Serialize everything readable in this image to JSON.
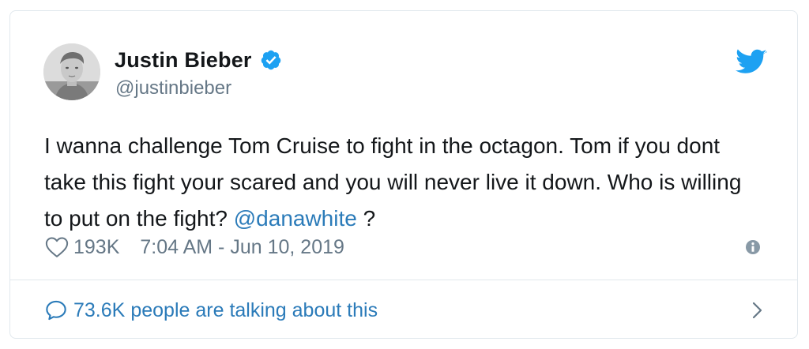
{
  "author": {
    "display_name": "Justin Bieber",
    "handle": "@justinbieber",
    "verified": true,
    "avatar_icon": "profile-photo-icon"
  },
  "tweet": {
    "text_before_mention": "I wanna challenge Tom Cruise to fight in the octagon. Tom if you dont take this fight your scared and you will never live it down. Who is willing to put on the fight? ",
    "mention": "@danawhite",
    "text_after_mention": " ?"
  },
  "meta": {
    "likes": "193K",
    "timestamp": "7:04 AM - Jun 10, 2019"
  },
  "conversation": {
    "count": "73.6K",
    "label": "people are talking about this"
  },
  "icons": {
    "brand": "twitter-bird-icon",
    "verified": "verified-badge-icon",
    "like": "heart-icon",
    "info": "info-icon",
    "reply": "speech-bubble-icon",
    "more": "chevron-right-icon"
  },
  "colors": {
    "brand_blue": "#1da1f2",
    "link_blue": "#2b7bb9",
    "text": "#14171a",
    "secondary_text": "#657786",
    "border": "#e1e8ed",
    "icon_gray": "#8899a6"
  }
}
